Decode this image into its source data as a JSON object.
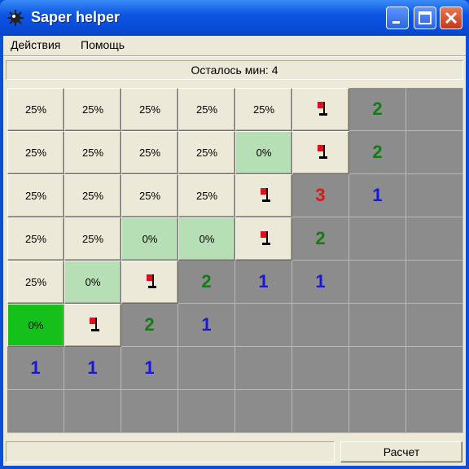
{
  "window": {
    "title": "Saper helper"
  },
  "menu": {
    "items": [
      "Действия",
      "Помощь"
    ]
  },
  "status": {
    "mines_left": "Осталось мин: 4"
  },
  "board": {
    "cols": 8,
    "rows": 8,
    "cells": [
      [
        {
          "t": "pct",
          "v": "25%"
        },
        {
          "t": "pct",
          "v": "25%"
        },
        {
          "t": "pct",
          "v": "25%"
        },
        {
          "t": "pct",
          "v": "25%"
        },
        {
          "t": "pct",
          "v": "25%"
        },
        {
          "t": "flag"
        },
        {
          "t": "num",
          "v": "2"
        },
        {
          "t": "empty"
        }
      ],
      [
        {
          "t": "pct",
          "v": "25%"
        },
        {
          "t": "pct",
          "v": "25%"
        },
        {
          "t": "pct",
          "v": "25%"
        },
        {
          "t": "pct",
          "v": "25%"
        },
        {
          "t": "safe",
          "v": "0%"
        },
        {
          "t": "flag"
        },
        {
          "t": "num",
          "v": "2"
        },
        {
          "t": "empty"
        }
      ],
      [
        {
          "t": "pct",
          "v": "25%"
        },
        {
          "t": "pct",
          "v": "25%"
        },
        {
          "t": "pct",
          "v": "25%"
        },
        {
          "t": "pct",
          "v": "25%"
        },
        {
          "t": "flag"
        },
        {
          "t": "num",
          "v": "3"
        },
        {
          "t": "num",
          "v": "1"
        },
        {
          "t": "empty"
        }
      ],
      [
        {
          "t": "pct",
          "v": "25%"
        },
        {
          "t": "pct",
          "v": "25%"
        },
        {
          "t": "safe",
          "v": "0%"
        },
        {
          "t": "safe",
          "v": "0%"
        },
        {
          "t": "flag"
        },
        {
          "t": "num",
          "v": "2"
        },
        {
          "t": "empty"
        },
        {
          "t": "empty"
        }
      ],
      [
        {
          "t": "pct",
          "v": "25%"
        },
        {
          "t": "safe",
          "v": "0%"
        },
        {
          "t": "flag"
        },
        {
          "t": "num",
          "v": "2"
        },
        {
          "t": "num",
          "v": "1"
        },
        {
          "t": "num",
          "v": "1"
        },
        {
          "t": "empty"
        },
        {
          "t": "empty"
        }
      ],
      [
        {
          "t": "best",
          "v": "0%"
        },
        {
          "t": "flag"
        },
        {
          "t": "num",
          "v": "2"
        },
        {
          "t": "num",
          "v": "1"
        },
        {
          "t": "empty"
        },
        {
          "t": "empty"
        },
        {
          "t": "empty"
        },
        {
          "t": "empty"
        }
      ],
      [
        {
          "t": "num",
          "v": "1"
        },
        {
          "t": "num",
          "v": "1"
        },
        {
          "t": "num",
          "v": "1"
        },
        {
          "t": "empty"
        },
        {
          "t": "empty"
        },
        {
          "t": "empty"
        },
        {
          "t": "empty"
        },
        {
          "t": "empty"
        }
      ],
      [
        {
          "t": "empty"
        },
        {
          "t": "empty"
        },
        {
          "t": "empty"
        },
        {
          "t": "empty"
        },
        {
          "t": "empty"
        },
        {
          "t": "empty"
        },
        {
          "t": "empty"
        },
        {
          "t": "empty"
        }
      ]
    ]
  },
  "footer": {
    "calc_button": "Расчет",
    "status_text": ""
  },
  "colors": {
    "title_bar": "#0a4fd8",
    "safe_cell": "#b7dfb6",
    "best_cell": "#16c01a",
    "num_1": "#1818d8",
    "num_2": "#157a15",
    "num_3": "#e21414",
    "flag": "#d8141a"
  },
  "icons": {
    "app": "mine-icon",
    "minimize": "minimize-icon",
    "maximize": "maximize-icon",
    "close": "close-icon",
    "flag": "flag-icon"
  }
}
